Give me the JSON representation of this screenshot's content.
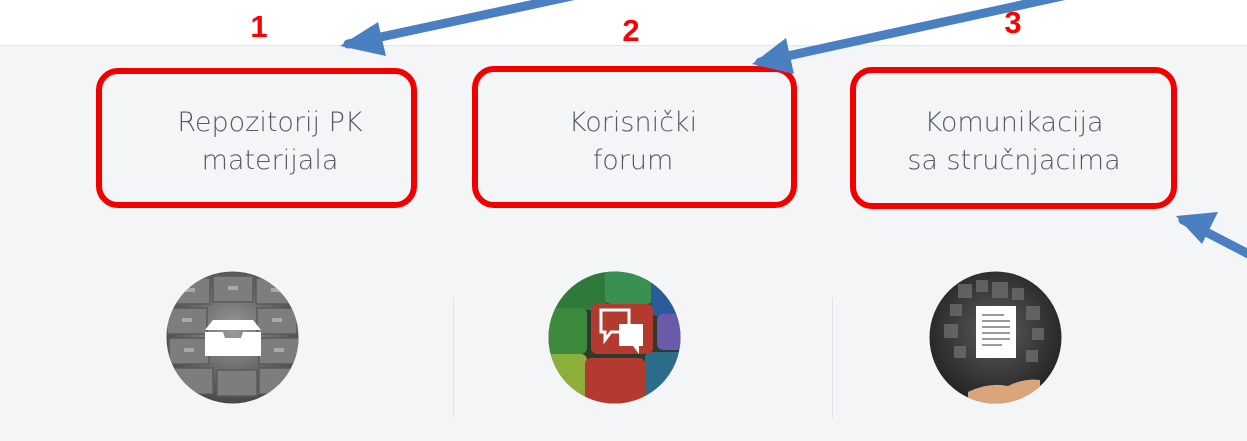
{
  "tiles": [
    {
      "number": "1",
      "line1": "Repozitorij PK",
      "line2": "materijala",
      "icon": "file-cabinet-icon"
    },
    {
      "number": "2",
      "line1": "Korisnički",
      "line2": "forum",
      "icon": "chat-bubbles-icon"
    },
    {
      "number": "3",
      "line1": "Komunikacija",
      "line2": "sa stručnjacima",
      "icon": "document-hand-icon"
    }
  ],
  "colors": {
    "highlight": "#f20000",
    "number": "#ff0000",
    "arrow": "#4a7fc1",
    "panel_bg": "#f4f5f7",
    "label_text": "#555a60"
  }
}
